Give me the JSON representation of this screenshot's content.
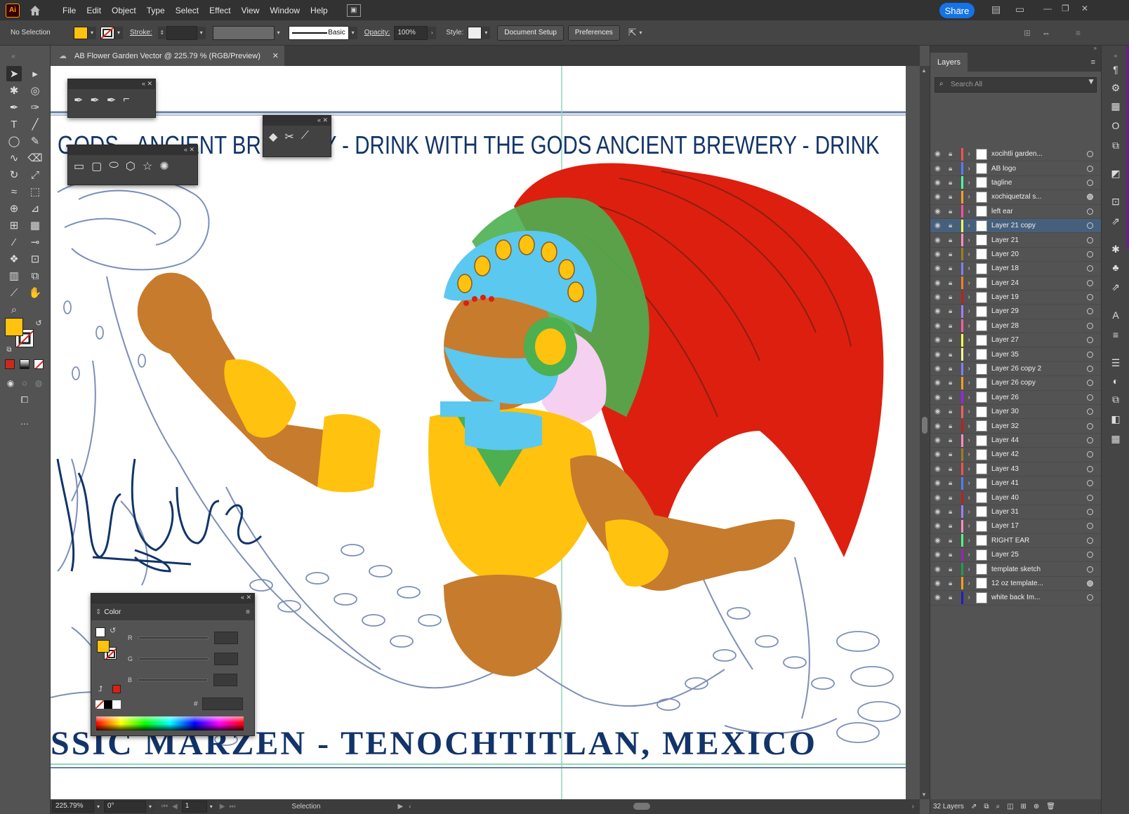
{
  "app": {
    "logo": "Ai"
  },
  "menu": [
    "File",
    "Edit",
    "Object",
    "Type",
    "Select",
    "Effect",
    "View",
    "Window",
    "Help"
  ],
  "share_label": "Share",
  "control_bar": {
    "selection_status": "No Selection",
    "stroke_label": "Stroke:",
    "brush_label": "Basic",
    "opacity_label": "Opacity:",
    "opacity_value": "100%",
    "style_label": "Style:",
    "document_setup": "Document Setup",
    "preferences": "Preferences",
    "fill_color": "#ffc20e"
  },
  "document": {
    "tab_title": "AB Flower Garden Vector @ 225.79 % (RGB/Preview)"
  },
  "artwork": {
    "top_banner": "GODS - ANCIENT BREWERY - DRINK WITH THE GODS   ANCIENT BREWERY - DRINK",
    "bottom_banner": "SSIC MARZEN - TENOCHTITLAN, MEXICO",
    "banner_color": "#123469"
  },
  "statusbar": {
    "zoom": "225.79%",
    "rotation": "0°",
    "artboard": "1",
    "tool": "Selection"
  },
  "layers_panel": {
    "title": "Layers",
    "search_placeholder": "Search All",
    "count": "32 Layers",
    "layers": [
      {
        "name": "xocihtli garden...",
        "color": "#ff4f4f",
        "target": "empty"
      },
      {
        "name": "AB logo",
        "color": "#4f7fff",
        "target": "empty"
      },
      {
        "name": "tagline",
        "color": "#4fffa0",
        "target": "empty"
      },
      {
        "name": "xochiquetzal s...",
        "color": "#ff9f1f",
        "target": "filled"
      },
      {
        "name": "left ear",
        "color": "#ff4fa0",
        "target": "empty"
      },
      {
        "name": "Layer 21 copy",
        "color": "#ffff4f",
        "target": "empty",
        "selected": true
      },
      {
        "name": "Layer 21",
        "color": "#ff8fbf",
        "target": "empty"
      },
      {
        "name": "Layer 20",
        "color": "#9f7f1f",
        "target": "empty"
      },
      {
        "name": "Layer 18",
        "color": "#7f7fff",
        "target": "empty"
      },
      {
        "name": "Layer 24",
        "color": "#ff7f1f",
        "target": "empty"
      },
      {
        "name": "Layer 19",
        "color": "#bf1f1f",
        "target": "empty"
      },
      {
        "name": "Layer 29",
        "color": "#9f7fff",
        "target": "empty"
      },
      {
        "name": "Layer 28",
        "color": "#ff5f9f",
        "target": "empty"
      },
      {
        "name": "Layer 27",
        "color": "#ffff4f",
        "target": "empty"
      },
      {
        "name": "Layer 35",
        "color": "#ffff8f",
        "target": "empty"
      },
      {
        "name": "Layer 26 copy 2",
        "color": "#7f7fff",
        "target": "empty"
      },
      {
        "name": "Layer 26 copy",
        "color": "#ff9f1f",
        "target": "empty"
      },
      {
        "name": "Layer 26",
        "color": "#9f1fff",
        "target": "empty"
      },
      {
        "name": "Layer 30",
        "color": "#ff5f5f",
        "target": "empty"
      },
      {
        "name": "Layer 32",
        "color": "#bf1f1f",
        "target": "empty"
      },
      {
        "name": "Layer 44",
        "color": "#ff8fbf",
        "target": "empty"
      },
      {
        "name": "Layer 42",
        "color": "#9f7f1f",
        "target": "empty"
      },
      {
        "name": "Layer 43",
        "color": "#ff4f4f",
        "target": "empty"
      },
      {
        "name": "Layer 41",
        "color": "#4f7fff",
        "target": "empty"
      },
      {
        "name": "Layer 40",
        "color": "#bf1f1f",
        "target": "empty"
      },
      {
        "name": "Layer 31",
        "color": "#9f7fff",
        "target": "empty"
      },
      {
        "name": "Layer 17",
        "color": "#ff8fbf",
        "target": "empty"
      },
      {
        "name": "RIGHT EAR",
        "color": "#4fff7f",
        "target": "empty"
      },
      {
        "name": "Layer 25",
        "color": "#9f1fbf",
        "target": "empty"
      },
      {
        "name": "template sketch",
        "color": "#1f9f4f",
        "target": "empty"
      },
      {
        "name": "12 oz template...",
        "color": "#ff9f1f",
        "target": "filled"
      },
      {
        "name": "white back Im...",
        "color": "#1f1fbf",
        "target": "empty"
      }
    ]
  },
  "color_panel": {
    "title": "Color",
    "channels": [
      "R",
      "G",
      "B"
    ],
    "hex_label": "#"
  },
  "icons": {
    "home": "home-icon",
    "search": "search-icon",
    "filter": "filter-icon"
  }
}
